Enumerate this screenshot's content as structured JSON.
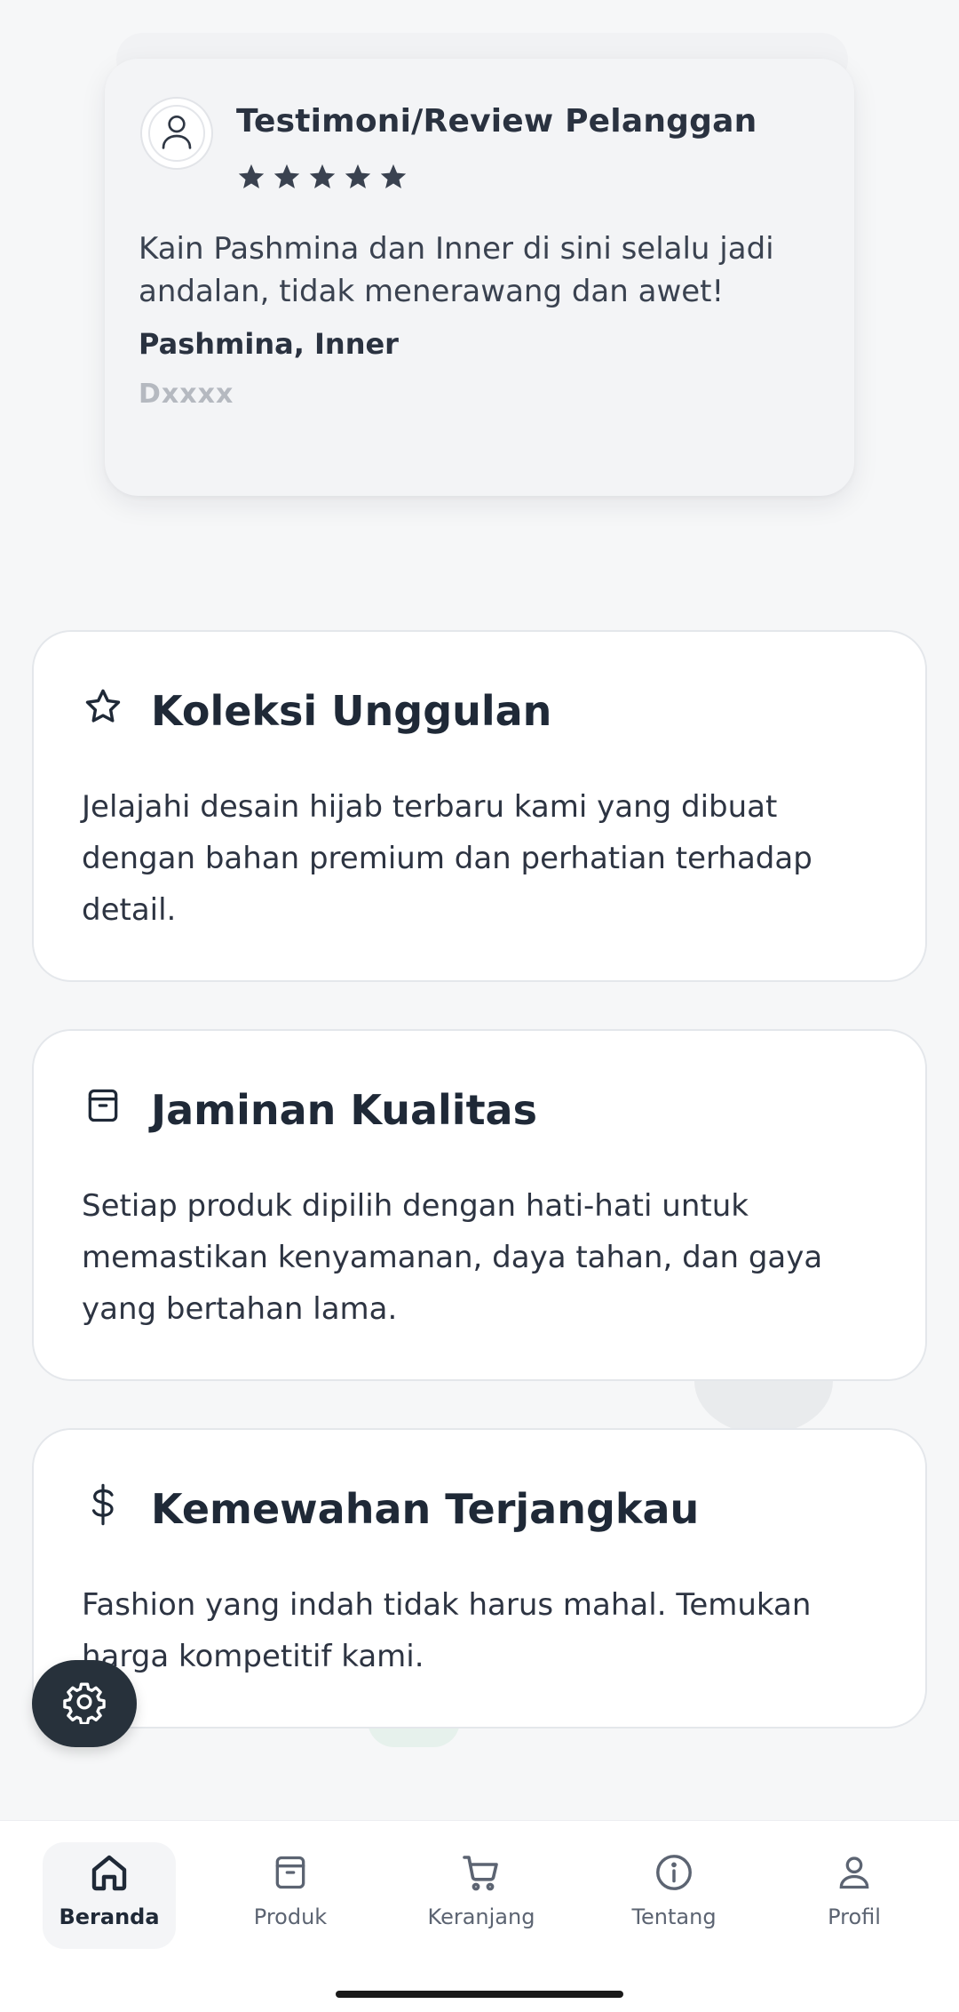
{
  "testimonial": {
    "title": "Testimoni/Review Pelanggan",
    "rating": 5,
    "text": "Kain Pashmina dan Inner di sini selalu jadi andalan, tidak menerawang dan awet!",
    "products": "Pashmina, Inner",
    "customer_name": "Dxxxx"
  },
  "features": [
    {
      "icon": "star-icon",
      "title": "Koleksi Unggulan",
      "text": "Jelajahi desain hijab terbaru kami yang dibuat dengan bahan premium dan perhatian terhadap detail."
    },
    {
      "icon": "archive-box-icon",
      "title": "Jaminan Kualitas",
      "text": "Setiap produk dipilih dengan hati-hati untuk memastikan kenyamanan, daya tahan, dan gaya yang bertahan lama."
    },
    {
      "icon": "dollar-icon",
      "title": "Kemewahan Terjangkau",
      "text": "Fashion yang indah tidak harus mahal. Temukan harga kompetitif kami."
    }
  ],
  "settings_fab": {
    "icon": "gear-icon"
  },
  "bottom_nav": {
    "active": "Beranda",
    "items": [
      {
        "label": "Beranda",
        "icon": "home-icon"
      },
      {
        "label": "Produk",
        "icon": "box-icon"
      },
      {
        "label": "Keranjang",
        "icon": "cart-icon"
      },
      {
        "label": "Tentang",
        "icon": "info-icon"
      },
      {
        "label": "Profil",
        "icon": "user-icon"
      }
    ]
  },
  "colors": {
    "background": "#f6f7f8",
    "card": "#ffffff",
    "text_primary": "#1f2937",
    "fab_background": "#27313b",
    "star": "#3a4250"
  }
}
